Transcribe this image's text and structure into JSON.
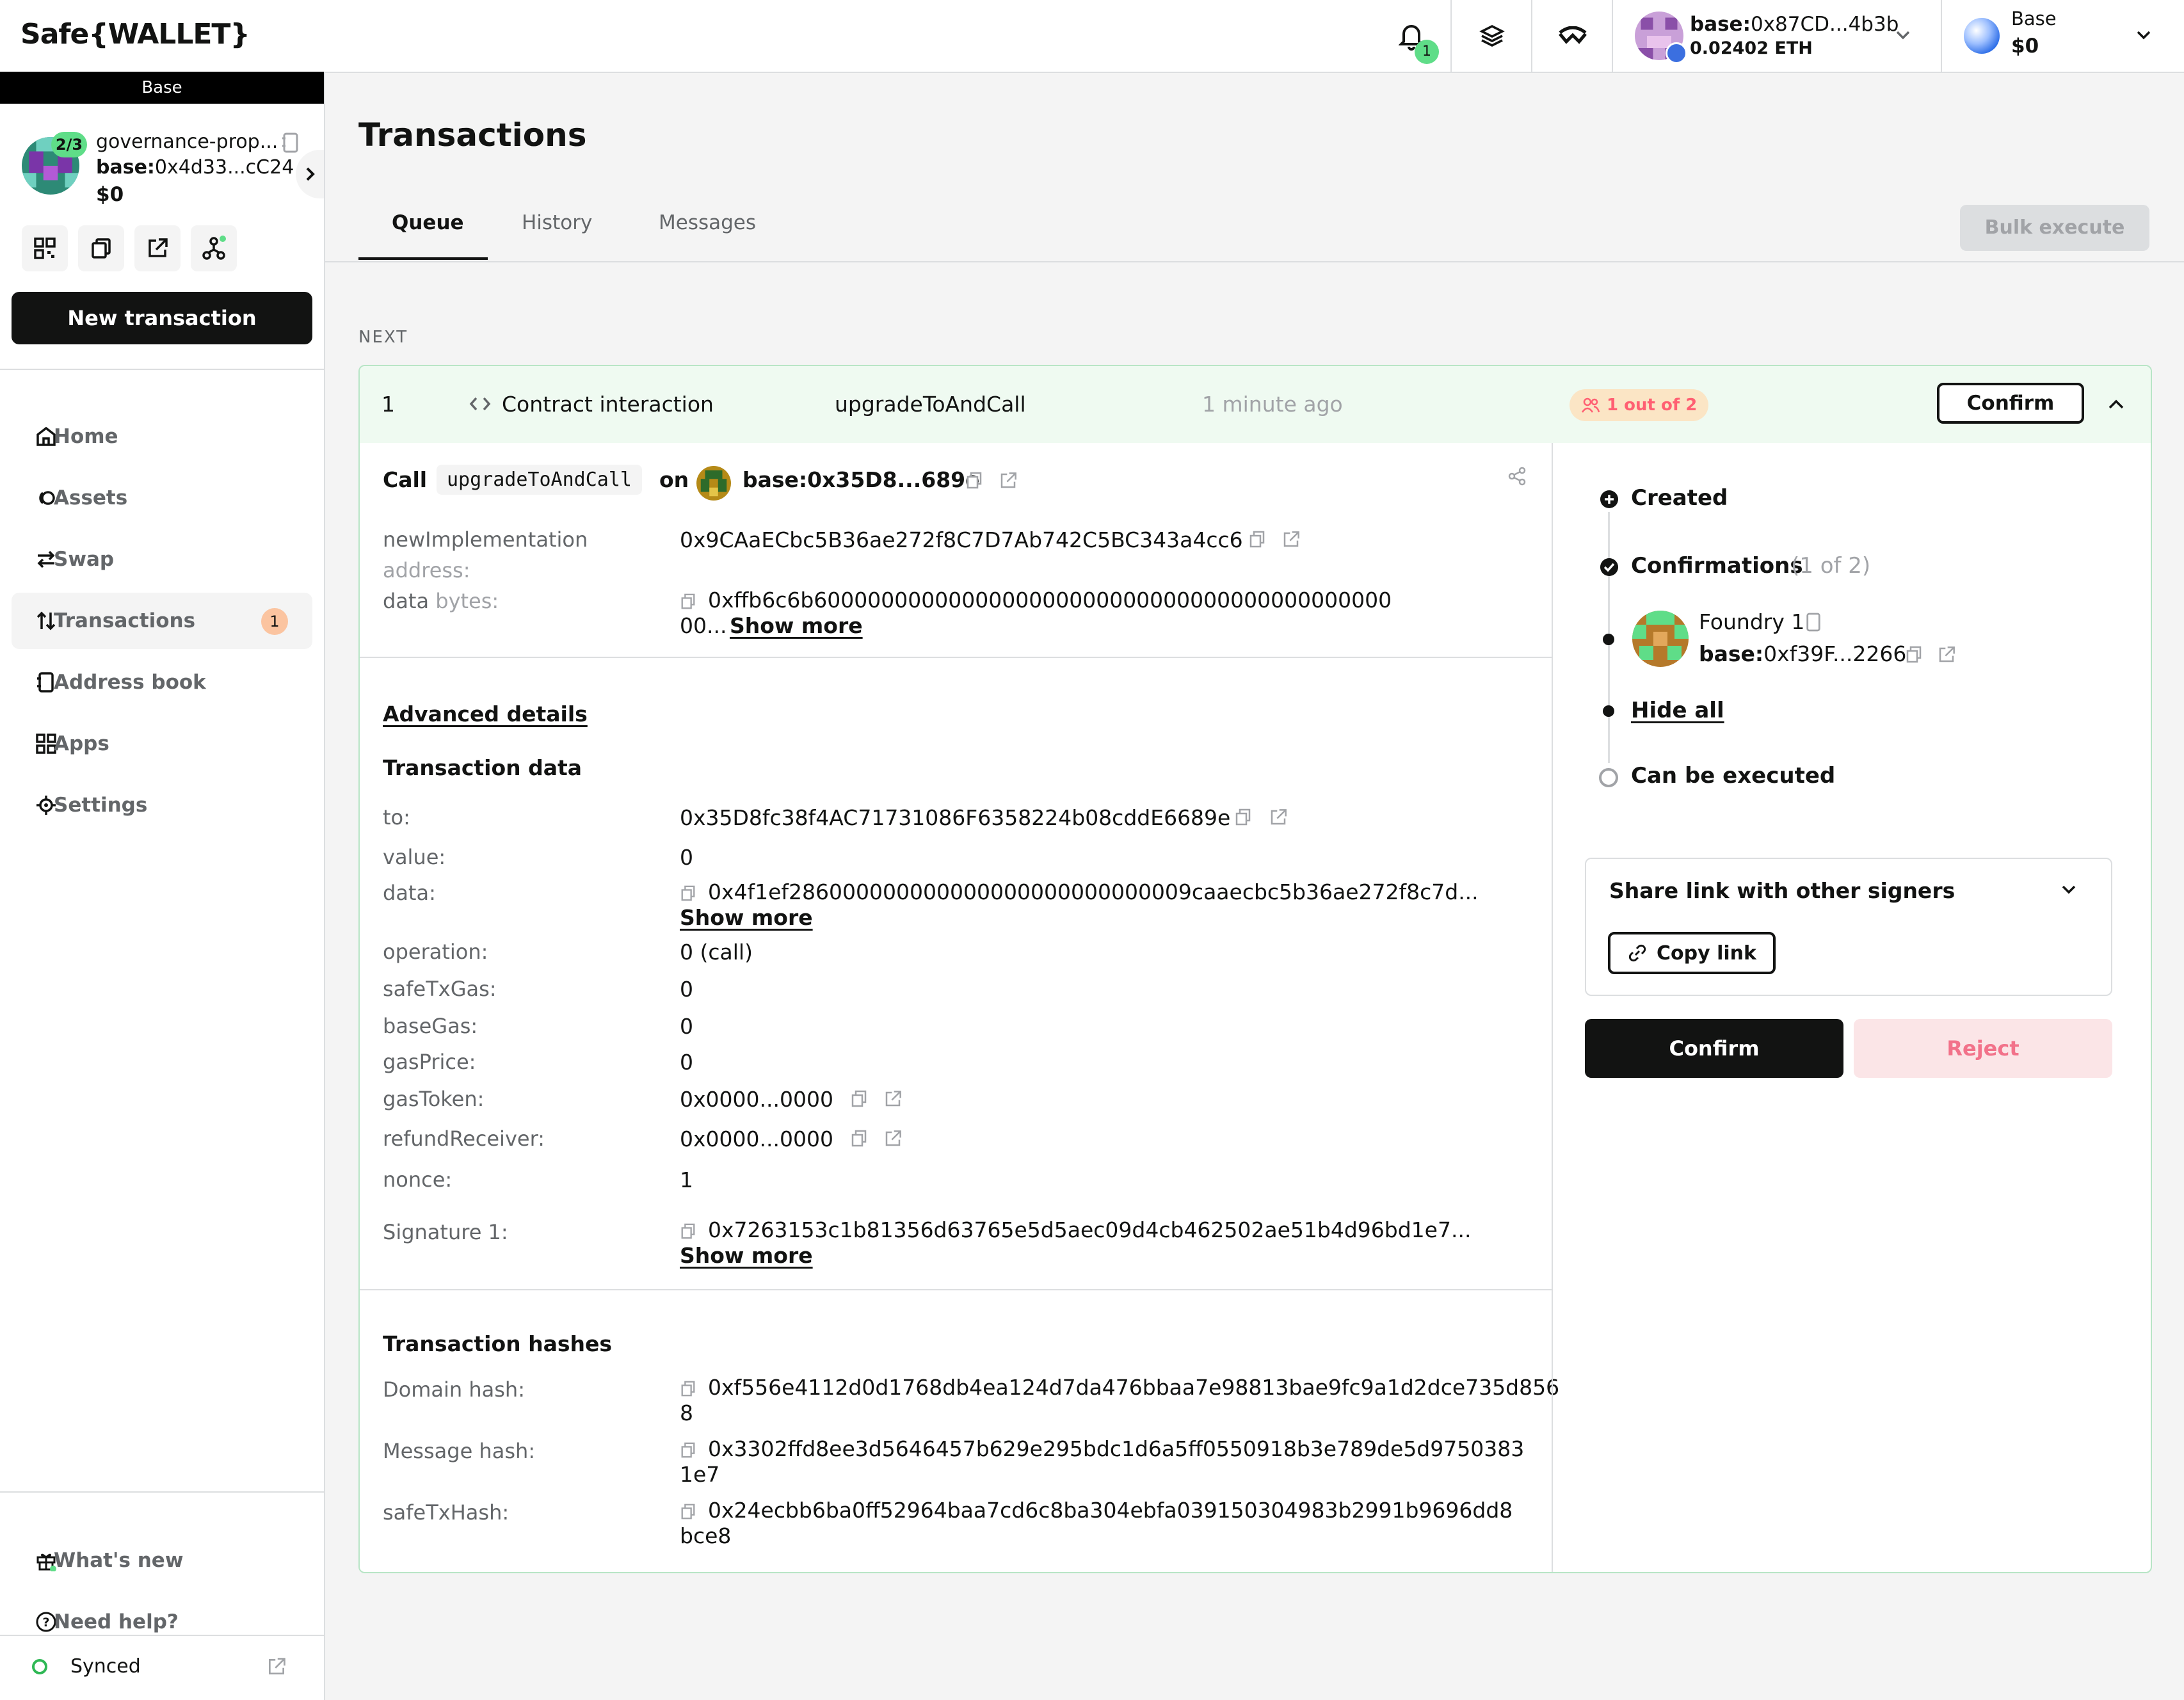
{
  "header": {
    "logo": "Safe{WALLET}",
    "notification_count": "1",
    "account": {
      "address_prefix": "base:",
      "address": "0x87CD...4b3b",
      "balance": "0.02402 ETH"
    },
    "network": {
      "name": "Base",
      "balance": "$0"
    }
  },
  "sidebar": {
    "chain_label": "Base",
    "safe": {
      "threshold": "2/3",
      "name": "governance-prop...",
      "address_prefix": "base:",
      "address": "0x4d33...cC24",
      "balance": "$0"
    },
    "new_transaction": "New transaction",
    "nav": [
      {
        "label": "Home",
        "icon": "home-icon"
      },
      {
        "label": "Assets",
        "icon": "assets-icon"
      },
      {
        "label": "Swap",
        "icon": "swap-icon"
      },
      {
        "label": "Transactions",
        "icon": "transactions-icon",
        "badge": "1"
      },
      {
        "label": "Address book",
        "icon": "address-book-icon"
      },
      {
        "label": "Apps",
        "icon": "apps-icon"
      },
      {
        "label": "Settings",
        "icon": "settings-icon"
      }
    ],
    "footer": {
      "whats_new": "What's new",
      "need_help": "Need help?",
      "synced": "Synced"
    }
  },
  "main": {
    "title": "Transactions",
    "tabs": [
      "Queue",
      "History",
      "Messages"
    ],
    "bulk_execute": "Bulk execute",
    "next_label": "NEXT"
  },
  "tx": {
    "nonce": "1",
    "type": "Contract interaction",
    "method": "upgradeToAndCall",
    "time": "1 minute ago",
    "confirmations_badge": "1 out of 2",
    "confirm_label": "Confirm",
    "call": {
      "call_word": "Call",
      "method": "upgradeToAndCall",
      "on_word": "on",
      "target": "base:0x35D8...689e"
    },
    "params": [
      {
        "name": "newImplementation",
        "type": "address:",
        "value": "0x9CAaECbc5B36ae272f8C7D7Ab742C5BC343a4cc6"
      },
      {
        "name": "data",
        "type": "bytes:",
        "value": "0xffb6c6b6000000000000000000000000000000000000000000",
        "value_line2": "00...",
        "show_more": "Show more"
      }
    ],
    "advanced_details": "Advanced details",
    "transaction_data_title": "Transaction data",
    "tx_data": {
      "to_label": "to:",
      "to": "0x35D8fc38f4AC71731086F6358224b08cddE6689e",
      "value_label": "value:",
      "value": "0",
      "data_label": "data:",
      "data": "0x4f1ef286000000000000000000000000009caaecbc5b36ae272f8c7d...",
      "data_more": "Show more",
      "operation_label": "operation:",
      "operation": "0 (call)",
      "safeTxGas_label": "safeTxGas:",
      "safeTxGas": "0",
      "baseGas_label": "baseGas:",
      "baseGas": "0",
      "gasPrice_label": "gasPrice:",
      "gasPrice": "0",
      "gasToken_label": "gasToken:",
      "gasToken": "0x0000...0000",
      "refundReceiver_label": "refundReceiver:",
      "refundReceiver": "0x0000...0000",
      "nonce_label": "nonce:",
      "nonce": "1",
      "signature_label": "Signature 1:",
      "signature": "0x7263153c1b81356d63765e5d5aec09d4cb462502ae51b4d96bd1e7...",
      "signature_more": "Show more"
    },
    "hashes_title": "Transaction hashes",
    "hashes": {
      "domain_label": "Domain hash:",
      "domain_l1": "0xf556e4112d0d1768db4ea124d7da476bbaa7e98813bae9fc9a1d2dce735d856",
      "domain_l2": "8",
      "message_label": "Message hash:",
      "message_l1": "0x3302ffd8ee3d5646457b629e295bdc1d6a5ff0550918b3e789de5d9750383",
      "message_l2": "1e7",
      "safetx_label": "safeTxHash:",
      "safetx_l1": "0x24ecbb6ba0ff52964baa7cd6c8ba304ebfa039150304983b2991b9696dd8",
      "safetx_l2": "bce8"
    }
  },
  "status_panel": {
    "created": "Created",
    "confirmations": "Confirmations",
    "confirmations_count": "(1 of 2)",
    "signer": {
      "name": "Foundry 1",
      "address_prefix": "base:",
      "address": "0xf39F...2266"
    },
    "hide_all": "Hide all",
    "can_be_executed": "Can be executed",
    "share_title": "Share link with other signers",
    "copy_link": "Copy link",
    "confirm": "Confirm",
    "reject": "Reject"
  },
  "colors": {
    "accent_green": "#5fdd88",
    "reject_bg": "#fbe5e7",
    "badge_orange": "#fbe5c5",
    "card_border": "#b8e5c6"
  }
}
